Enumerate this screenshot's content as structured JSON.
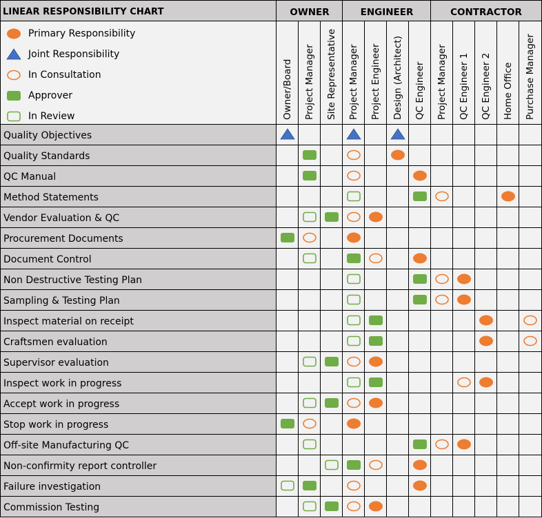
{
  "chart_data": {
    "type": "table",
    "title": "LINEAR RESPONSIBILITY CHART",
    "groups": [
      {
        "name": "OWNER",
        "span": 3
      },
      {
        "name": "ENGINEER",
        "span": 4
      },
      {
        "name": "CONTRACTOR",
        "span": 5
      }
    ],
    "columns": [
      "Owner/Board",
      "Project Manager",
      "Site Representative",
      "Project Manager",
      "Project Engineer",
      "Design (Architect)",
      "QC Engineer",
      "Project Manager",
      "QC Engineer 1",
      "QC Engineer 2",
      "Home Office",
      "Purchase Manager"
    ],
    "legend": [
      {
        "key": "primary",
        "label": "Primary Responsibility",
        "shape": "filled-oval",
        "color": "#ED7D31"
      },
      {
        "key": "joint",
        "label": "Joint Responsibility",
        "shape": "triangle",
        "color": "#4472C4"
      },
      {
        "key": "consultation",
        "label": "In Consultation",
        "shape": "hollow-oval",
        "color": "#ED7D31"
      },
      {
        "key": "approver",
        "label": "Approver",
        "shape": "filled-rounded-rect",
        "color": "#70AD47"
      },
      {
        "key": "review",
        "label": "In Review",
        "shape": "hollow-rounded-rect",
        "color": "#70AD47"
      }
    ],
    "rows": [
      {
        "task": "Quality Objectives",
        "cells": [
          "joint",
          "",
          "",
          "joint",
          "",
          "joint",
          "",
          "",
          "",
          "",
          "",
          ""
        ]
      },
      {
        "task": "Quality Standards",
        "cells": [
          "",
          "approver",
          "",
          "consultation",
          "",
          "primary",
          "",
          "",
          "",
          "",
          "",
          ""
        ]
      },
      {
        "task": "QC Manual",
        "cells": [
          "",
          "approver",
          "",
          "consultation",
          "",
          "",
          "primary",
          "",
          "",
          "",
          "",
          ""
        ]
      },
      {
        "task": "Method Statements",
        "cells": [
          "",
          "",
          "",
          "review",
          "",
          "",
          "approver",
          "consultation",
          "",
          "",
          "primary",
          ""
        ]
      },
      {
        "task": "Vendor Evaluation & QC",
        "cells": [
          "",
          "review",
          "approver",
          "consultation",
          "primary",
          "",
          "",
          "",
          "",
          "",
          "",
          ""
        ]
      },
      {
        "task": "Procurement Documents",
        "cells": [
          "approver",
          "consultation",
          "",
          "primary",
          "",
          "",
          "",
          "",
          "",
          "",
          "",
          ""
        ]
      },
      {
        "task": "Document Control",
        "cells": [
          "",
          "review",
          "",
          "approver",
          "consultation",
          "",
          "primary",
          "",
          "",
          "",
          "",
          ""
        ]
      },
      {
        "task": "Non Destructive Testing Plan",
        "cells": [
          "",
          "",
          "",
          "review",
          "",
          "",
          "approver",
          "consultation",
          "primary",
          "",
          "",
          ""
        ]
      },
      {
        "task": "Sampling & Testing Plan",
        "cells": [
          "",
          "",
          "",
          "review",
          "",
          "",
          "approver",
          "consultation",
          "primary",
          "",
          "",
          ""
        ]
      },
      {
        "task": "Inspect material on receipt",
        "cells": [
          "",
          "",
          "",
          "review",
          "approver",
          "",
          "",
          "",
          "",
          "primary",
          "",
          "consultation"
        ]
      },
      {
        "task": "Craftsmen evaluation",
        "cells": [
          "",
          "",
          "",
          "review",
          "approver",
          "",
          "",
          "",
          "",
          "primary",
          "",
          "consultation"
        ]
      },
      {
        "task": "Supervisor evaluation",
        "cells": [
          "",
          "review",
          "approver",
          "consultation",
          "primary",
          "",
          "",
          "",
          "",
          "",
          "",
          ""
        ]
      },
      {
        "task": "Inspect work in progress",
        "cells": [
          "",
          "",
          "",
          "review",
          "approver",
          "",
          "",
          "",
          "consultation",
          "primary",
          "",
          ""
        ]
      },
      {
        "task": "Accept work in progress",
        "cells": [
          "",
          "review",
          "approver",
          "consultation",
          "primary",
          "",
          "",
          "",
          "",
          "",
          "",
          ""
        ]
      },
      {
        "task": "Stop work in progress",
        "cells": [
          "approver",
          "consultation",
          "",
          "primary",
          "",
          "",
          "",
          "",
          "",
          "",
          "",
          ""
        ]
      },
      {
        "task": "Off-site Manufacturing QC",
        "cells": [
          "",
          "review",
          "",
          "",
          "",
          "",
          "approver",
          "consultation",
          "primary",
          "",
          "",
          ""
        ]
      },
      {
        "task": "Non-confirmity report controller",
        "cells": [
          "",
          "",
          "review",
          "approver",
          "consultation",
          "",
          "primary",
          "",
          "",
          "",
          "",
          ""
        ]
      },
      {
        "task": "Failure investigation",
        "cells": [
          "review",
          "approver",
          "",
          "consultation",
          "",
          "",
          "primary",
          "",
          "",
          "",
          "",
          ""
        ]
      },
      {
        "task": "Commission Testing",
        "cells": [
          "",
          "review",
          "approver",
          "consultation",
          "primary",
          "",
          "",
          "",
          "",
          "",
          "",
          ""
        ]
      }
    ]
  },
  "colors": {
    "orange": "#ED7D31",
    "blue": "#4472C4",
    "green": "#70AD47",
    "header_gray": "#D0CECE",
    "cell_bg": "#F2F2F2"
  }
}
